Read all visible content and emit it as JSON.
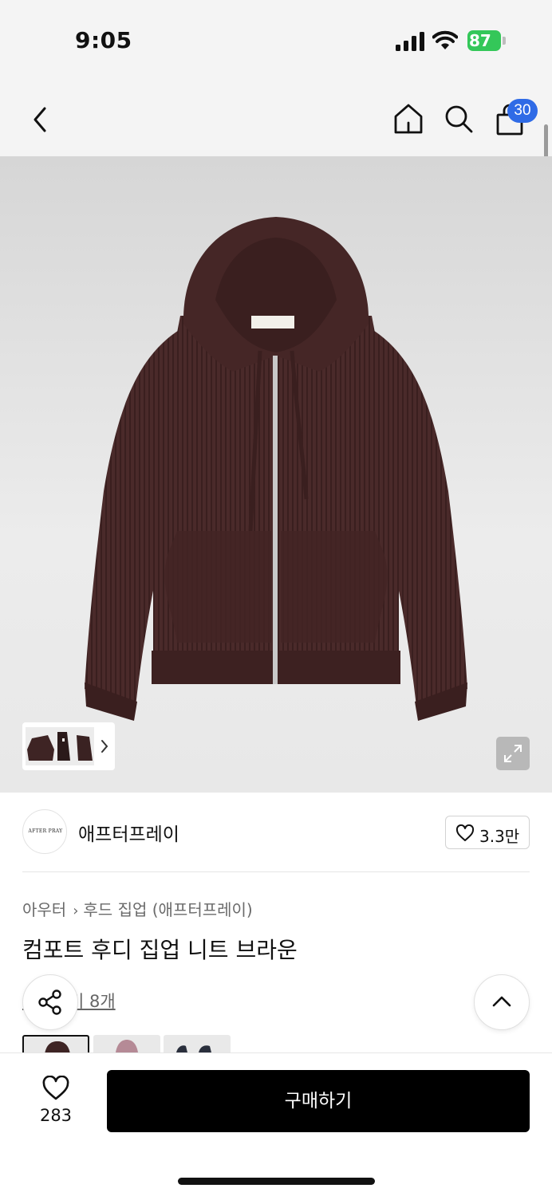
{
  "status_bar": {
    "time": "9:05",
    "battery_level": "87",
    "battery_color": "#34c759",
    "icons": [
      "signal-icon",
      "wifi-icon",
      "battery-icon"
    ]
  },
  "nav": {
    "icons": [
      "back-icon",
      "home-icon",
      "search-icon",
      "shopping-bag-icon"
    ],
    "cart_count": "30",
    "badge_color": "#2f6be6"
  },
  "product": {
    "image_description_icon": "expand-icon",
    "thumbnail_chevron": "chevron-right-icon"
  },
  "brand": {
    "logo_text": "AFTER PRAY",
    "name": "애프터프레이",
    "likes": "3.3만"
  },
  "breadcrumb": {
    "category": "아우터",
    "subcategory": "후드 집업 (애프터프레이)"
  },
  "title": "컴포트 후디 집업 니트 브라운",
  "review": {
    "label": "리뷰보기 8개"
  },
  "floating": {
    "share_icon": "share-icon",
    "top_icon": "chevron-up-icon"
  },
  "swatches": [
    "brown",
    "pink",
    "navy"
  ],
  "bottom": {
    "wish_count": "283",
    "buy_label": "구매하기"
  }
}
